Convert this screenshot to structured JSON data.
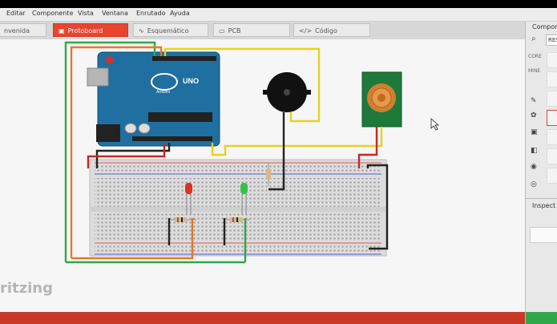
{
  "menu": [
    "Editar",
    "Componente",
    "Vista",
    "Ventana",
    "Enrutado",
    "Ayuda"
  ],
  "tabs": [
    {
      "label": "nvenida",
      "icon": "home-icon",
      "active": false
    },
    {
      "label": "Protoboard",
      "icon": "breadboard-icon",
      "active": true
    },
    {
      "label": "Esquemático",
      "icon": "schematic-icon",
      "active": false
    },
    {
      "label": "PCB",
      "icon": "pcb-icon",
      "active": false
    },
    {
      "label": "Código",
      "icon": "code-icon",
      "active": false
    }
  ],
  "canvas": {
    "watermark": "ritzing",
    "arduino_brand": "UNO",
    "arduino_sub": "Arduino"
  },
  "parts_panel": {
    "title": "Compone",
    "search_value": "RESI",
    "categories": [
      "CORE",
      "MINE",
      "",
      ""
    ]
  },
  "inspector": {
    "title": "Inspect"
  },
  "colors": {
    "accent": "#e9442e",
    "arduino": "#1f6fa0",
    "wire_green": "#2fa84a",
    "wire_orange": "#e07a2b",
    "wire_yellow": "#e8d21d",
    "wire_black": "#222222",
    "wire_red": "#c8281e"
  }
}
